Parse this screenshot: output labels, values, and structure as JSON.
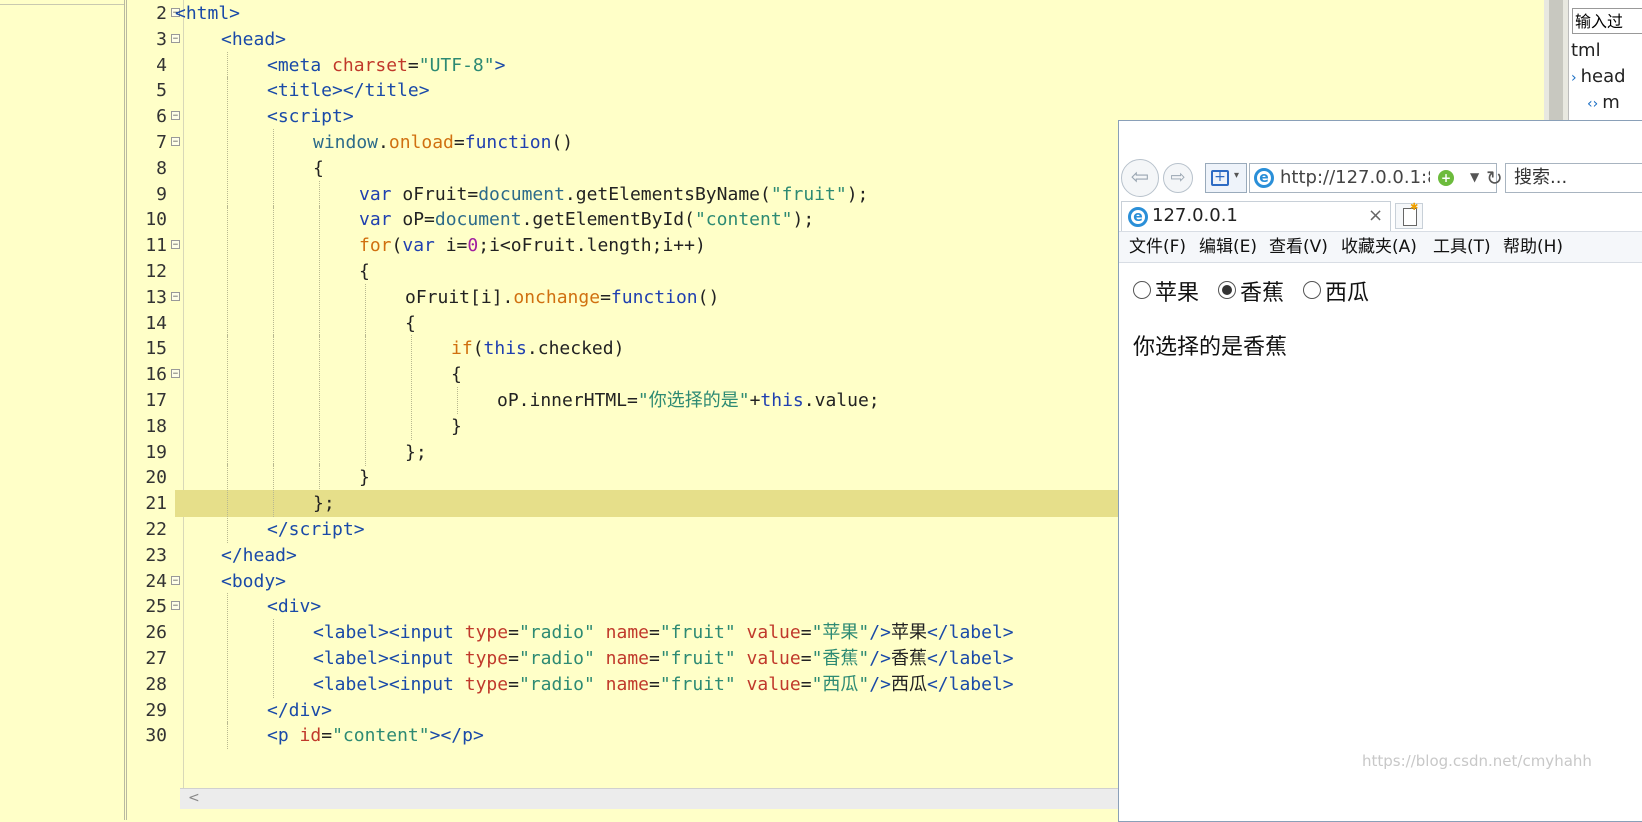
{
  "editor": {
    "lines": [
      {
        "n": "2",
        "fold": true,
        "indent": 0,
        "html": "<span class=\"t-tag\">&lt;html&gt;</span>"
      },
      {
        "n": "3",
        "fold": true,
        "indent": 1,
        "html": "<span class=\"t-tag\">&lt;head&gt;</span>"
      },
      {
        "n": "4",
        "fold": false,
        "indent": 2,
        "html": "<span class=\"t-tag\">&lt;meta</span> <span class=\"t-attr\">charset</span>=<span class=\"t-str\">\"UTF-8\"</span><span class=\"t-tag\">&gt;</span>"
      },
      {
        "n": "5",
        "fold": false,
        "indent": 2,
        "html": "<span class=\"t-tag\">&lt;title&gt;&lt;/title&gt;</span>"
      },
      {
        "n": "6",
        "fold": true,
        "indent": 2,
        "html": "<span class=\"t-tag\">&lt;script&gt;</span>"
      },
      {
        "n": "7",
        "fold": true,
        "indent": 3,
        "html": "<span class=\"t-fn\">window</span>.<span class=\"t-ev\">onload</span>=<span class=\"t-kw\">function</span>()"
      },
      {
        "n": "8",
        "fold": false,
        "indent": 3,
        "html": "{"
      },
      {
        "n": "9",
        "fold": false,
        "indent": 4,
        "html": "<span class=\"t-kw\">var</span> oFruit=<span class=\"t-fn\">document</span>.getElementsByName(<span class=\"t-str\">\"fruit\"</span>);"
      },
      {
        "n": "10",
        "fold": false,
        "indent": 4,
        "html": "<span class=\"t-kw\">var</span> oP=<span class=\"t-fn\">document</span>.getElementById(<span class=\"t-str\">\"content\"</span>);"
      },
      {
        "n": "11",
        "fold": true,
        "indent": 4,
        "html": "<span class=\"t-ev\">for</span>(<span class=\"t-kw\">var</span> i=<span class=\"t-num\">0</span>;i&lt;oFruit.length;i++)"
      },
      {
        "n": "12",
        "fold": false,
        "indent": 4,
        "html": "{"
      },
      {
        "n": "13",
        "fold": true,
        "indent": 5,
        "html": "oFruit[i].<span class=\"t-ev\">onchange</span>=<span class=\"t-kw\">function</span>()"
      },
      {
        "n": "14",
        "fold": false,
        "indent": 5,
        "html": "{"
      },
      {
        "n": "15",
        "fold": false,
        "indent": 6,
        "html": "<span class=\"t-ev\">if</span>(<span class=\"t-kw\">this</span>.checked)"
      },
      {
        "n": "16",
        "fold": true,
        "indent": 6,
        "html": "{"
      },
      {
        "n": "17",
        "fold": false,
        "indent": 7,
        "html": "oP.innerHTML=<span class=\"t-str\">\"你选择的是\"</span>+<span class=\"t-kw\">this</span>.value;"
      },
      {
        "n": "18",
        "fold": false,
        "indent": 6,
        "html": "}"
      },
      {
        "n": "19",
        "fold": false,
        "indent": 5,
        "html": "};"
      },
      {
        "n": "20",
        "fold": false,
        "indent": 4,
        "html": "}"
      },
      {
        "n": "21",
        "fold": false,
        "indent": 3,
        "html": "};",
        "current": true
      },
      {
        "n": "22",
        "fold": false,
        "indent": 2,
        "html": "<span class=\"t-tag\">&lt;/script&gt;</span>"
      },
      {
        "n": "23",
        "fold": false,
        "indent": 1,
        "html": "<span class=\"t-tag\">&lt;/head&gt;</span>"
      },
      {
        "n": "24",
        "fold": true,
        "indent": 1,
        "html": "<span class=\"t-tag\">&lt;body&gt;</span>"
      },
      {
        "n": "25",
        "fold": true,
        "indent": 2,
        "html": "<span class=\"t-tag\">&lt;div&gt;</span>"
      },
      {
        "n": "26",
        "fold": false,
        "indent": 3,
        "html": "<span class=\"t-tag\">&lt;label&gt;&lt;input</span> <span class=\"t-attr\">type</span>=<span class=\"t-str\">\"radio\"</span> <span class=\"t-attr\">name</span>=<span class=\"t-str\">\"fruit\"</span> <span class=\"t-attr\">value</span>=<span class=\"t-str\">\"苹果\"</span><span class=\"t-tag\">/&gt;</span>苹果<span class=\"t-tag\">&lt;/label&gt;</span>"
      },
      {
        "n": "27",
        "fold": false,
        "indent": 3,
        "html": "<span class=\"t-tag\">&lt;label&gt;&lt;input</span> <span class=\"t-attr\">type</span>=<span class=\"t-str\">\"radio\"</span> <span class=\"t-attr\">name</span>=<span class=\"t-str\">\"fruit\"</span> <span class=\"t-attr\">value</span>=<span class=\"t-str\">\"香蕉\"</span><span class=\"t-tag\">/&gt;</span>香蕉<span class=\"t-tag\">&lt;/label&gt;</span>"
      },
      {
        "n": "28",
        "fold": false,
        "indent": 3,
        "html": "<span class=\"t-tag\">&lt;label&gt;&lt;input</span> <span class=\"t-attr\">type</span>=<span class=\"t-str\">\"radio\"</span> <span class=\"t-attr\">name</span>=<span class=\"t-str\">\"fruit\"</span> <span class=\"t-attr\">value</span>=<span class=\"t-str\">\"西瓜\"</span><span class=\"t-tag\">/&gt;</span>西瓜<span class=\"t-tag\">&lt;/label&gt;</span>"
      },
      {
        "n": "29",
        "fold": false,
        "indent": 2,
        "html": "<span class=\"t-tag\">&lt;/div&gt;</span>"
      },
      {
        "n": "30",
        "fold": false,
        "indent": 2,
        "html": "<span class=\"t-tag\">&lt;p</span> <span class=\"t-attr\">id</span>=<span class=\"t-str\">\"content\"</span><span class=\"t-tag\">&gt;&lt;/p&gt;</span>"
      }
    ]
  },
  "right_panel": {
    "filter_placeholder": "输入过",
    "tree_items": [
      {
        "label": "tml",
        "caret": ""
      },
      {
        "label": "head",
        "caret": "›"
      },
      {
        "label": "m",
        "caret": "‹›"
      }
    ]
  },
  "browser": {
    "url": "http://127.0.0.1:8",
    "search_placeholder": "搜索...",
    "tab_title": "127.0.0.1",
    "tab_close": "×",
    "menu": [
      "文件(F)",
      "编辑(E)",
      "查看(V)",
      "收藏夹(A)",
      "工具(T)",
      "帮助(H)"
    ],
    "radios": [
      {
        "label": "苹果",
        "checked": false
      },
      {
        "label": "香蕉",
        "checked": true
      },
      {
        "label": "西瓜",
        "checked": false
      }
    ],
    "content_text": "你选择的是香蕉"
  },
  "watermark": "https://blog.csdn.net/cmyhahh",
  "colors": {
    "editor_bg": "#ffffc8",
    "current_line": "#e6df8a",
    "tag": "#1a4aa8",
    "attr": "#c0392b",
    "string": "#2d8a73",
    "keyword": "#2040b0",
    "event": "#d07010"
  }
}
